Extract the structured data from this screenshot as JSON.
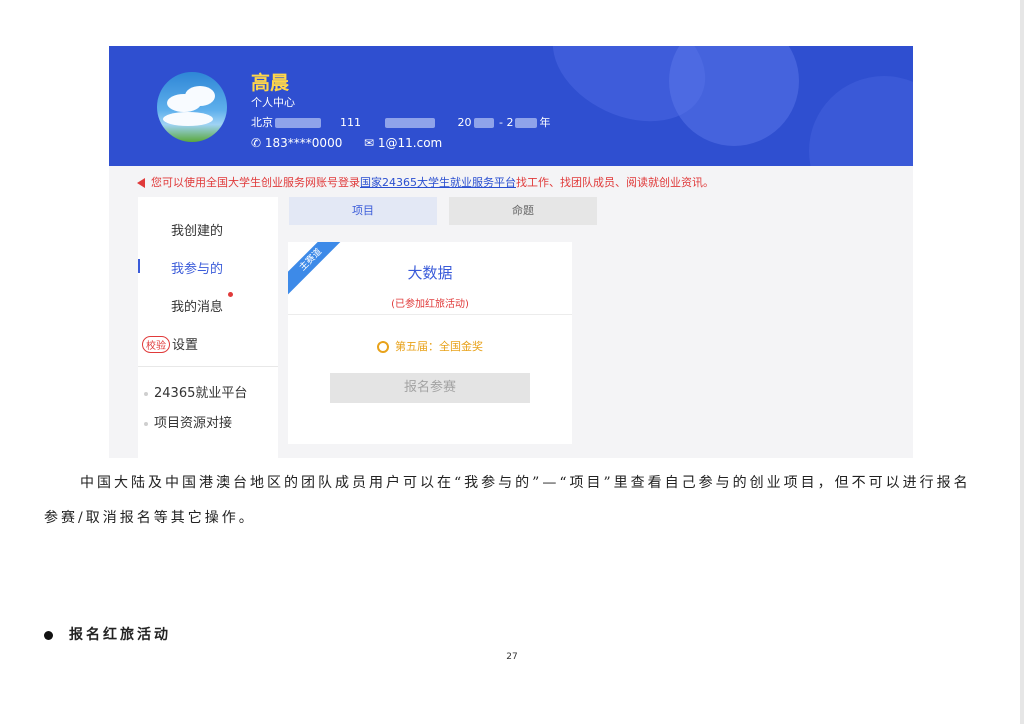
{
  "profile": {
    "name": "高晨",
    "center_label": "个人中心",
    "info_a": "北京",
    "info_b": "111",
    "info_c": "20",
    "info_d": "- 2",
    "info_e": "年",
    "phone": "183****0000",
    "email": "1@11.com"
  },
  "notice": {
    "prefix": "您可以使用全国大学生创业服务网账号登录",
    "link": "国家24365大学生就业服务平台",
    "suffix": "找工作、找团队成员、阅读就创业资讯。"
  },
  "sidebar": {
    "items": [
      {
        "label": "我创建的"
      },
      {
        "label": "我参与的"
      },
      {
        "label": "我的消息"
      },
      {
        "badge": "校验",
        "label": "设置"
      }
    ],
    "links": [
      {
        "label": "24365就业平台"
      },
      {
        "label": "项目资源对接"
      }
    ]
  },
  "tabs": [
    {
      "label": "项目",
      "active": true
    },
    {
      "label": "命题",
      "active": false
    }
  ],
  "card": {
    "ribbon": "主赛道",
    "title": "大数据",
    "status": "(已参加红旅活动)",
    "award": "第五届：全国金奖",
    "button": "报名参赛"
  },
  "document": {
    "paragraph": "中国大陆及中国港澳台地区的团队成员用户可以在“我参与的”—“项目”里查看自己参与的创业项目，但不可以进行报名参赛/取消报名等其它操作。",
    "bullet": "报名红旅活动",
    "page_number": "27"
  },
  "colors": {
    "banner": "#2f4fd0",
    "accent": "#3a5bd9",
    "alert": "#e03a3a",
    "award": "#e8a21a"
  }
}
